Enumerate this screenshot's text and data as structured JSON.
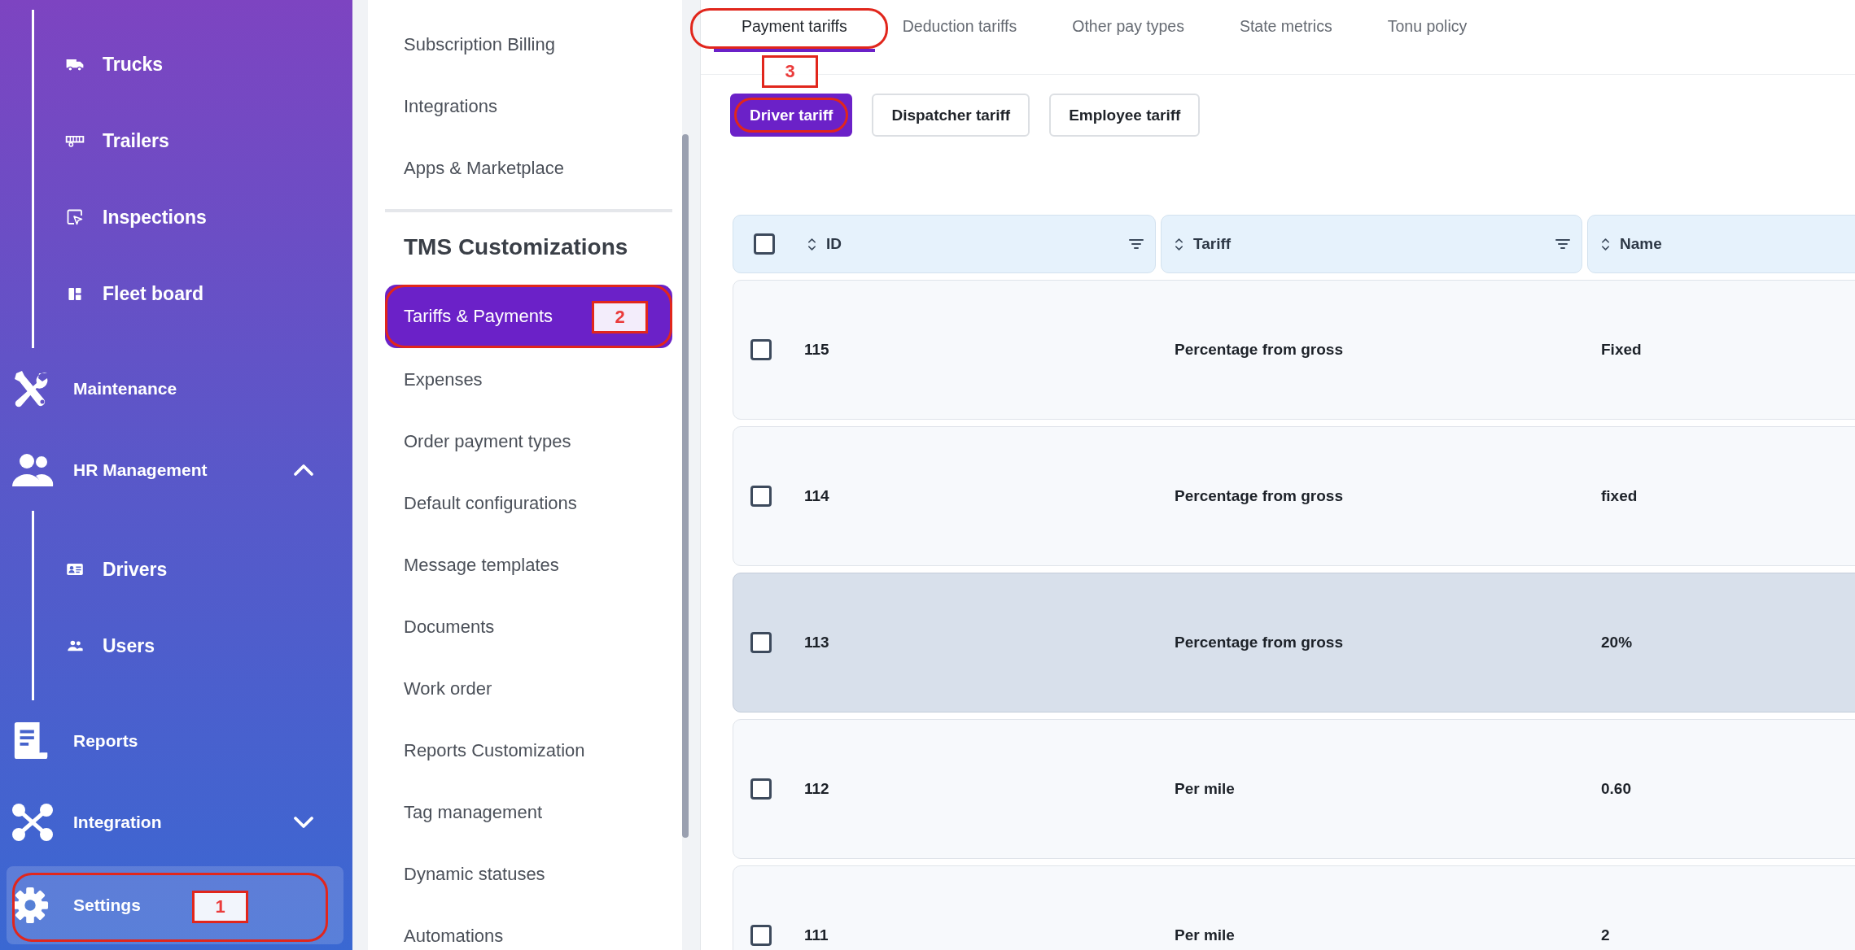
{
  "sidebar": {
    "items": [
      {
        "kind": "sublist",
        "children": [
          {
            "label": "Trucks"
          },
          {
            "label": "Trailers"
          },
          {
            "label": "Inspections"
          },
          {
            "label": "Fleet board"
          }
        ]
      },
      {
        "kind": "link",
        "label": "Maintenance",
        "selected": false
      },
      {
        "kind": "group",
        "label": "HR Management",
        "selected": false,
        "expanded": true,
        "children": [
          {
            "label": "Drivers"
          },
          {
            "label": "Users"
          }
        ]
      },
      {
        "kind": "link",
        "label": "Reports",
        "selected": false
      },
      {
        "kind": "group",
        "label": "Integration",
        "selected": false,
        "expanded": false
      },
      {
        "kind": "link",
        "label": "Settings",
        "selected": true,
        "circled": true,
        "callout": "1"
      }
    ]
  },
  "settings_menu": {
    "items": [
      {
        "kind": "link",
        "label": "Subscription Billing",
        "selected": false
      },
      {
        "kind": "link",
        "label": "Integrations",
        "selected": false
      },
      {
        "kind": "link",
        "label": "Apps & Marketplace",
        "selected": false
      },
      {
        "kind": "heading",
        "label": "TMS Customizations"
      },
      {
        "kind": "link",
        "label": "Tariffs & Payments",
        "selected": true,
        "circled": true,
        "callout": "2"
      },
      {
        "kind": "link",
        "label": "Expenses",
        "selected": false
      },
      {
        "kind": "link",
        "label": "Order payment types",
        "selected": false
      },
      {
        "kind": "link",
        "label": "Default configurations",
        "selected": false
      },
      {
        "kind": "link",
        "label": "Message templates",
        "selected": false
      },
      {
        "kind": "link",
        "label": "Documents",
        "selected": false
      },
      {
        "kind": "link",
        "label": "Work order",
        "selected": false
      },
      {
        "kind": "link",
        "label": "Reports Customization",
        "selected": false
      },
      {
        "kind": "link",
        "label": "Tag management",
        "selected": false
      },
      {
        "kind": "link",
        "label": "Dynamic statuses",
        "selected": false
      },
      {
        "kind": "link",
        "label": "Automations",
        "selected": false
      }
    ]
  },
  "tabs": [
    {
      "label": "Payment tariffs",
      "selected": true,
      "circled": true,
      "callout": "3"
    },
    {
      "label": "Deduction tariffs",
      "selected": false
    },
    {
      "label": "Other pay types",
      "selected": false
    },
    {
      "label": "State metrics",
      "selected": false
    },
    {
      "label": "Tonu policy",
      "selected": false
    }
  ],
  "tariff_types": [
    {
      "label": "Driver tariff",
      "selected": true,
      "circled": true
    },
    {
      "label": "Dispatcher tariff",
      "selected": false
    },
    {
      "label": "Employee tariff",
      "selected": false
    }
  ],
  "table": {
    "select_all_checked": false,
    "columns": [
      {
        "label": "ID",
        "filter": true
      },
      {
        "label": "Tariff",
        "filter": true
      },
      {
        "label": "Name"
      }
    ],
    "rows": [
      {
        "checked": false,
        "highlighted": false,
        "cells": [
          "115",
          "Percentage from gross",
          "Fixed"
        ]
      },
      {
        "checked": false,
        "highlighted": false,
        "cells": [
          "114",
          "Percentage from gross",
          "fixed"
        ]
      },
      {
        "checked": false,
        "highlighted": true,
        "cells": [
          "113",
          "Percentage from gross",
          "20%"
        ]
      },
      {
        "checked": false,
        "highlighted": false,
        "cells": [
          "112",
          "Per mile",
          "0.60"
        ]
      },
      {
        "checked": false,
        "highlighted": false,
        "cells": [
          "111",
          "Per mile",
          "2"
        ]
      }
    ]
  }
}
